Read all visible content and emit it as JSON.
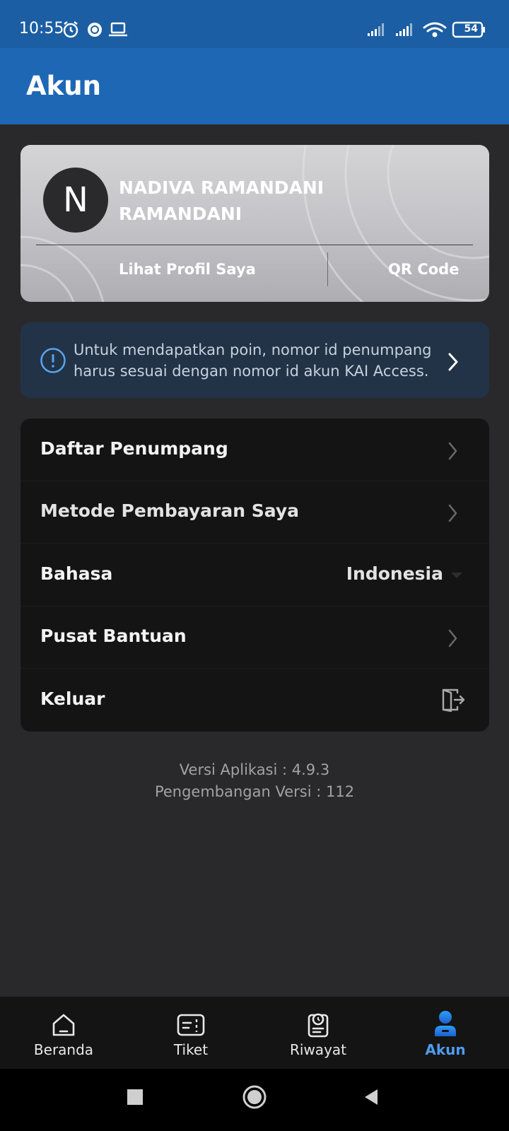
{
  "status_bar": {
    "time": "10:55",
    "battery": "54"
  },
  "header": {
    "title": "Akun"
  },
  "profile": {
    "initial": "N",
    "name": "NADIVA RAMANDANI RAMANDANI",
    "view_profile_label": "Lihat Profil Saya",
    "qr_code_label": "QR Code"
  },
  "info_banner": {
    "text": "Untuk mendapatkan poin, nomor id penumpang harus sesuai dengan nomor id akun KAI Access."
  },
  "menu": {
    "passenger_list": "Daftar Penumpang",
    "payment_methods": "Metode Pembayaran Saya",
    "language_label": "Bahasa",
    "language_value": "Indonesia",
    "help_center": "Pusat Bantuan",
    "logout": "Keluar"
  },
  "version": {
    "app_version": "Versi Aplikasi : 4.9.3",
    "build_version": "Pengembangan Versi : 112"
  },
  "bottom_nav": {
    "items": [
      {
        "label": "Beranda",
        "icon": "home-icon"
      },
      {
        "label": "Tiket",
        "icon": "ticket-icon"
      },
      {
        "label": "Riwayat",
        "icon": "history-icon"
      },
      {
        "label": "Akun",
        "icon": "account-icon",
        "active": true
      }
    ]
  },
  "colors": {
    "primary": "#1e67b5",
    "active_nav": "#4d9cf1",
    "background": "#29292b"
  }
}
